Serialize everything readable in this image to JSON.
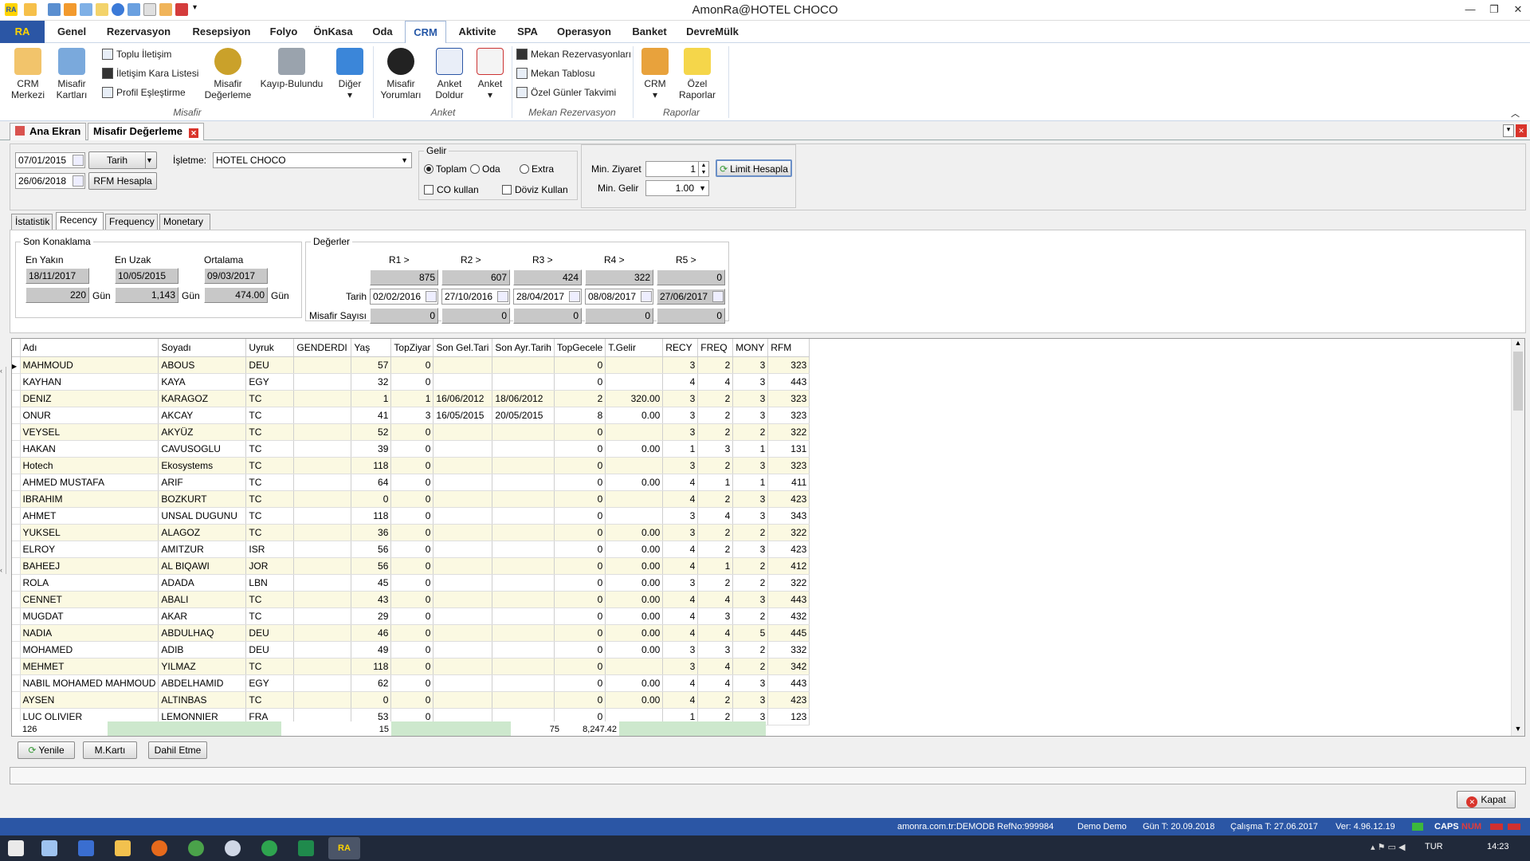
{
  "window": {
    "title": "AmonRa@HOTEL CHOCO"
  },
  "menu": {
    "ra": "RA",
    "items": [
      "Genel",
      "Rezervasyon",
      "Resepsiyon",
      "Folyo",
      "ÖnKasa",
      "Oda",
      "CRM",
      "Aktivite",
      "SPA",
      "Operasyon",
      "Banket",
      "DevreMülk"
    ],
    "active": "CRM"
  },
  "ribbon": {
    "crm_merkezi": [
      "CRM",
      "Merkezi"
    ],
    "misafir_kartlari": [
      "Misafir",
      "Kartları"
    ],
    "toplu_iletisim": "Toplu İletişim",
    "iletisim_kara": "İletişim Kara Listesi",
    "profil_eslestirme": "Profil Eşleştirme",
    "misafir_degerleme": [
      "Misafir",
      "Değerleme"
    ],
    "kayip_bulundu": "Kayıp-Bulundu",
    "diger": "Diğer",
    "misafir_yorumlari": [
      "Misafir",
      "Yorumları"
    ],
    "anket_doldur": [
      "Anket",
      "Doldur"
    ],
    "anket": "Anket",
    "mekan_rez": "Mekan Rezervasyonları",
    "mekan_tablosu": "Mekan Tablosu",
    "ozel_gunler": "Özel Günler Takvimi",
    "crm": "CRM",
    "ozel_raporlar": [
      "Özel",
      "Raporlar"
    ],
    "groups": [
      "Misafir",
      "Anket",
      "Mekan Rezervasyon",
      "Raporlar"
    ]
  },
  "doctabs": {
    "home": "Ana Ekran",
    "current": "Misafir Değerleme"
  },
  "filters": {
    "date_from": "07/01/2015",
    "date_to": "26/06/2018",
    "date_type": "Tarih",
    "rfm_button": "RFM Hesapla",
    "isletme_label": "İşletme:",
    "isletme_value": "HOTEL CHOCO",
    "gelir_legend": "Gelir",
    "radio_toplam": "Toplam",
    "radio_oda": "Oda",
    "radio_extra": "Extra",
    "co_kullan": "CO kullan",
    "doviz_kullan": "Döviz Kullan",
    "min_ziyaret_label": "Min. Ziyaret",
    "min_ziyaret": "1",
    "min_gelir_label": "Min. Gelir",
    "min_gelir": "1.00",
    "limit_button": "Limit Hesapla"
  },
  "subtabs": [
    "İstatistik",
    "Recency",
    "Frequency",
    "Monetary"
  ],
  "recency": {
    "son_konaklama": "Son Konaklama",
    "en_yakin_label": "En Yakın",
    "en_uzak_label": "En Uzak",
    "ortalama_label": "Ortalama",
    "en_yakin_date": "18/11/2017",
    "en_uzak_date": "10/05/2015",
    "ortalama_date": "09/03/2017",
    "en_yakin_days": "220",
    "en_uzak_days": "1,143",
    "ortalama_days": "474.00",
    "gun": "Gün",
    "degerler": "Değerler",
    "r_headers": [
      "R1 >",
      "R2 >",
      "R3 >",
      "R4 >",
      "R5 >"
    ],
    "r_values": [
      "875",
      "607",
      "424",
      "322",
      "0"
    ],
    "tarih_label": "Tarih",
    "r_dates": [
      "02/02/2016",
      "27/10/2016",
      "28/04/2017",
      "08/08/2017",
      "27/06/2017"
    ],
    "misafir_sayisi_label": "Misafir Sayısı",
    "r_counts": [
      "0",
      "0",
      "0",
      "0",
      "0"
    ]
  },
  "grid": {
    "columns": [
      "Adı",
      "Soyadı",
      "Uyruk",
      "GENDERDI",
      "Yaş",
      "TopZiyar",
      "Son Gel.Tari",
      "Son Ayr.Tarih",
      "TopGecele",
      "T.Gelir",
      "RECY",
      "FREQ",
      "MONY",
      "RFM"
    ],
    "rows": [
      [
        "MAHMOUD",
        "ABOUS",
        "DEU",
        "",
        "57",
        "0",
        "",
        "",
        "0",
        "",
        "3",
        "2",
        "3",
        "323"
      ],
      [
        "KAYHAN",
        "KAYA",
        "EGY",
        "",
        "32",
        "0",
        "",
        "",
        "0",
        "",
        "4",
        "4",
        "3",
        "443"
      ],
      [
        "DENIZ",
        "KARAGOZ",
        "TC",
        "",
        "1",
        "1",
        "16/06/2012",
        "18/06/2012",
        "2",
        "320.00",
        "3",
        "2",
        "3",
        "323"
      ],
      [
        "ONUR",
        "AKCAY",
        "TC",
        "",
        "41",
        "3",
        "16/05/2015",
        "20/05/2015",
        "8",
        "0.00",
        "3",
        "2",
        "3",
        "323"
      ],
      [
        "VEYSEL",
        "AKYÜZ",
        "TC",
        "",
        "52",
        "0",
        "",
        "",
        "0",
        "",
        "3",
        "2",
        "2",
        "322"
      ],
      [
        "HAKAN",
        "CAVUSOGLU",
        "TC",
        "",
        "39",
        "0",
        "",
        "",
        "0",
        "0.00",
        "1",
        "3",
        "1",
        "131"
      ],
      [
        "Hotech",
        "Ekosystems",
        "TC",
        "",
        "118",
        "0",
        "",
        "",
        "0",
        "",
        "3",
        "2",
        "3",
        "323"
      ],
      [
        "AHMED MUSTAFA",
        "ARIF",
        "TC",
        "",
        "64",
        "0",
        "",
        "",
        "0",
        "0.00",
        "4",
        "1",
        "1",
        "411"
      ],
      [
        "IBRAHIM",
        "BOZKURT",
        "TC",
        "",
        "0",
        "0",
        "",
        "",
        "0",
        "",
        "4",
        "2",
        "3",
        "423"
      ],
      [
        "AHMET",
        " UNSAL DUGUNU",
        "TC",
        "",
        "118",
        "0",
        "",
        "",
        "0",
        "",
        "3",
        "4",
        "3",
        "343"
      ],
      [
        "YUKSEL",
        "ALAGOZ",
        "TC",
        "",
        "36",
        "0",
        "",
        "",
        "0",
        "0.00",
        "3",
        "2",
        "2",
        "322"
      ],
      [
        "ELROY",
        "AMITZUR",
        "ISR",
        "",
        "56",
        "0",
        "",
        "",
        "0",
        "0.00",
        "4",
        "2",
        "3",
        "423"
      ],
      [
        "BAHEEJ",
        "AL BIQAWI",
        "JOR",
        "",
        "56",
        "0",
        "",
        "",
        "0",
        "0.00",
        "4",
        "1",
        "2",
        "412"
      ],
      [
        "ROLA",
        "ADADA",
        "LBN",
        "",
        "45",
        "0",
        "",
        "",
        "0",
        "0.00",
        "3",
        "2",
        "2",
        "322"
      ],
      [
        "CENNET",
        "ABALI",
        "TC",
        "",
        "43",
        "0",
        "",
        "",
        "0",
        "0.00",
        "4",
        "4",
        "3",
        "443"
      ],
      [
        "MUGDAT",
        "AKAR",
        "TC",
        "",
        "29",
        "0",
        "",
        "",
        "0",
        "0.00",
        "4",
        "3",
        "2",
        "432"
      ],
      [
        "NADIA",
        "ABDULHAQ",
        "DEU",
        "",
        "46",
        "0",
        "",
        "",
        "0",
        "0.00",
        "4",
        "4",
        "5",
        "445"
      ],
      [
        "MOHAMED",
        "ADIB",
        "DEU",
        "",
        "49",
        "0",
        "",
        "",
        "0",
        "0.00",
        "3",
        "3",
        "2",
        "332"
      ],
      [
        "MEHMET",
        " YILMAZ",
        "TC",
        "",
        "118",
        "0",
        "",
        "",
        "0",
        "",
        "3",
        "4",
        "2",
        "342"
      ],
      [
        "NABIL MOHAMED MAHMOUD",
        "ABDELHAMID",
        "EGY",
        "",
        "62",
        "0",
        "",
        "",
        "0",
        "0.00",
        "4",
        "4",
        "3",
        "443"
      ],
      [
        "AYSEN",
        "ALTINBAS",
        "TC",
        "",
        "0",
        "0",
        "",
        "",
        "0",
        "0.00",
        "4",
        "2",
        "3",
        "423"
      ],
      [
        "LUC OLIVIER",
        "LEMONNIER",
        "FRA",
        "",
        "53",
        "0",
        "",
        "",
        "0",
        "",
        "1",
        "2",
        "3",
        "123"
      ]
    ],
    "footer": {
      "count": "126",
      "topziyaret": "15",
      "topgecele": "75",
      "tgelir": "8,247.42"
    }
  },
  "buttons": {
    "yenile": "Yenile",
    "mkarti": "M.Kartı",
    "dahil_etme": "Dahil Etme",
    "kapat": "Kapat"
  },
  "statusbar": {
    "host": "amonra.com.tr:DEMODB RefNo:999984",
    "user": "Demo Demo",
    "gun": "Gün T: 20.09.2018",
    "calisma": "Çalışma T: 27.06.2017",
    "ver": "Ver: 4.96.12.19",
    "caps": "CAPS",
    "num": "NUM"
  },
  "taskbar": {
    "lang": "TUR",
    "time": "14:23"
  },
  "colors": {
    "accent": "#2b56a5",
    "row_alt": "#fbf9e2",
    "grid_footer": "#cde8cd"
  }
}
